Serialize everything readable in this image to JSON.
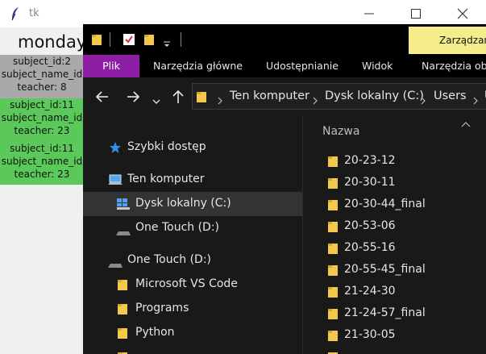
{
  "tk_window": {
    "title": "tk",
    "day_heading": "monday",
    "cards": [
      {
        "line1": "subject_id:2",
        "line2": "subject_name_id",
        "line3": "teacher: 8",
        "color": "#a9a9a9"
      },
      {
        "line1": "subject_id:11",
        "line2": "subject_name_id",
        "line3": "teacher: 23",
        "color": "#5ac95a"
      },
      {
        "line1": "subject_id:11",
        "line2": "subject_name_id",
        "line3": "teacher: 23",
        "color": "#5ac95a"
      }
    ]
  },
  "explorer": {
    "context_tab": "Zarządzanie",
    "ribbon_tabs": [
      "Plik",
      "Narzędzia główne",
      "Udostępnianie",
      "Widok",
      "Narzędzia obrazów"
    ],
    "active_tab_color": "#8e1ea3",
    "breadcrumb": [
      "Ten komputer",
      "Dysk lokalny (C:)",
      "Users",
      "U"
    ],
    "nav": {
      "quick_access": "Szybki dostęp",
      "this_pc": "Ten komputer",
      "local_disk": "Dysk lokalny (C:)",
      "one_touch_sub": "One Touch (D:)",
      "one_touch": "One Touch (D:)",
      "folders": [
        "Microsoft VS Code",
        "Programs",
        "Python"
      ]
    },
    "column_header": "Nazwa",
    "files": [
      "20-23-12",
      "20-30-11",
      "20-30-44_final",
      "20-53-06",
      "20-55-16",
      "20-55-45_final",
      "21-24-30",
      "21-24-57_final",
      "21-30-05"
    ],
    "folder_color": "#f2c94c"
  }
}
